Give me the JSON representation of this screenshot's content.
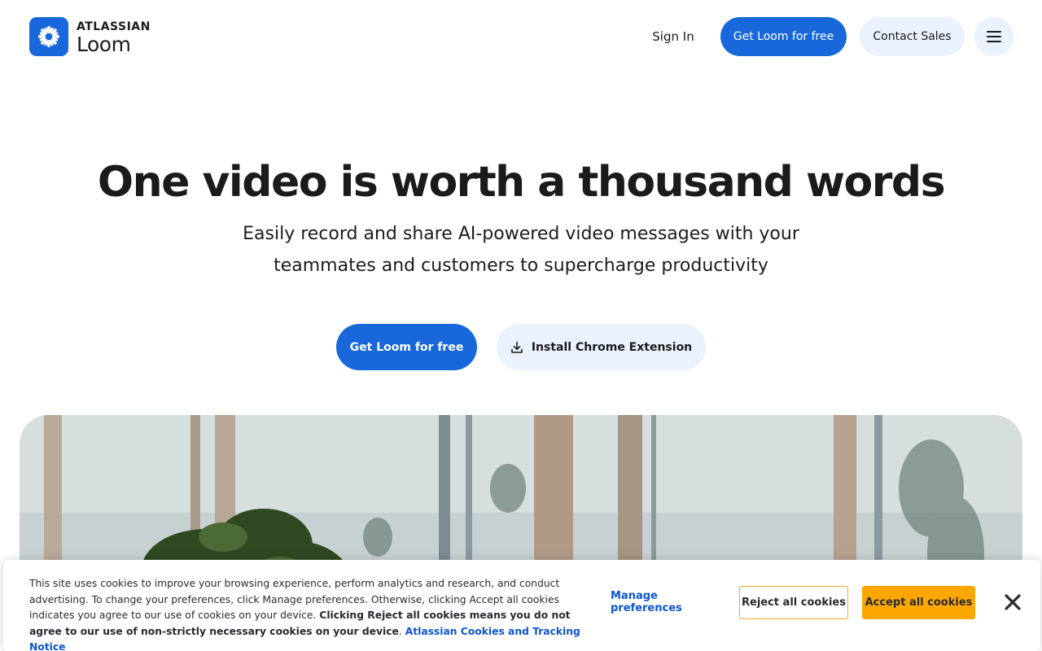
{
  "header": {
    "brand_top": "ATLASSIAN",
    "brand_name": "Loom",
    "logo_icon": "loom-logo-icon",
    "sign_in": "Sign In",
    "get_loom": "Get Loom for free",
    "contact_sales": "Contact Sales",
    "menu_icon": "hamburger-menu-icon"
  },
  "hero": {
    "title": "One video is worth a thousand words",
    "subtitle": "Easily record and share AI-powered video messages with your teammates and customers to supercharge productivity",
    "cta_primary": "Get Loom for free",
    "cta_secondary": "Install Chrome Extension",
    "cta_secondary_icon": "download-icon"
  },
  "cookie_banner": {
    "text": "This site uses cookies to improve your browsing experience, perform analytics and research, and conduct advertising. To change your preferences, click Manage preferences. Otherwise, clicking Accept all cookies indicates you agree to our use of cookies on your device. ",
    "text_bold": "Clicking Reject all cookies means you do not agree to our use of non-strictly necessary cookies on your device",
    "text_after": ". ",
    "link": "Atlassian Cookies and Tracking Notice",
    "manage": "Manage preferences",
    "reject": "Reject all cookies",
    "accept": "Accept all cookies",
    "close_icon": "close-icon"
  },
  "colors": {
    "brand_blue": "#1868db",
    "light_blue": "#e9f2fe",
    "accept_yellow": "#fca700",
    "link_blue": "#0c55cf"
  }
}
